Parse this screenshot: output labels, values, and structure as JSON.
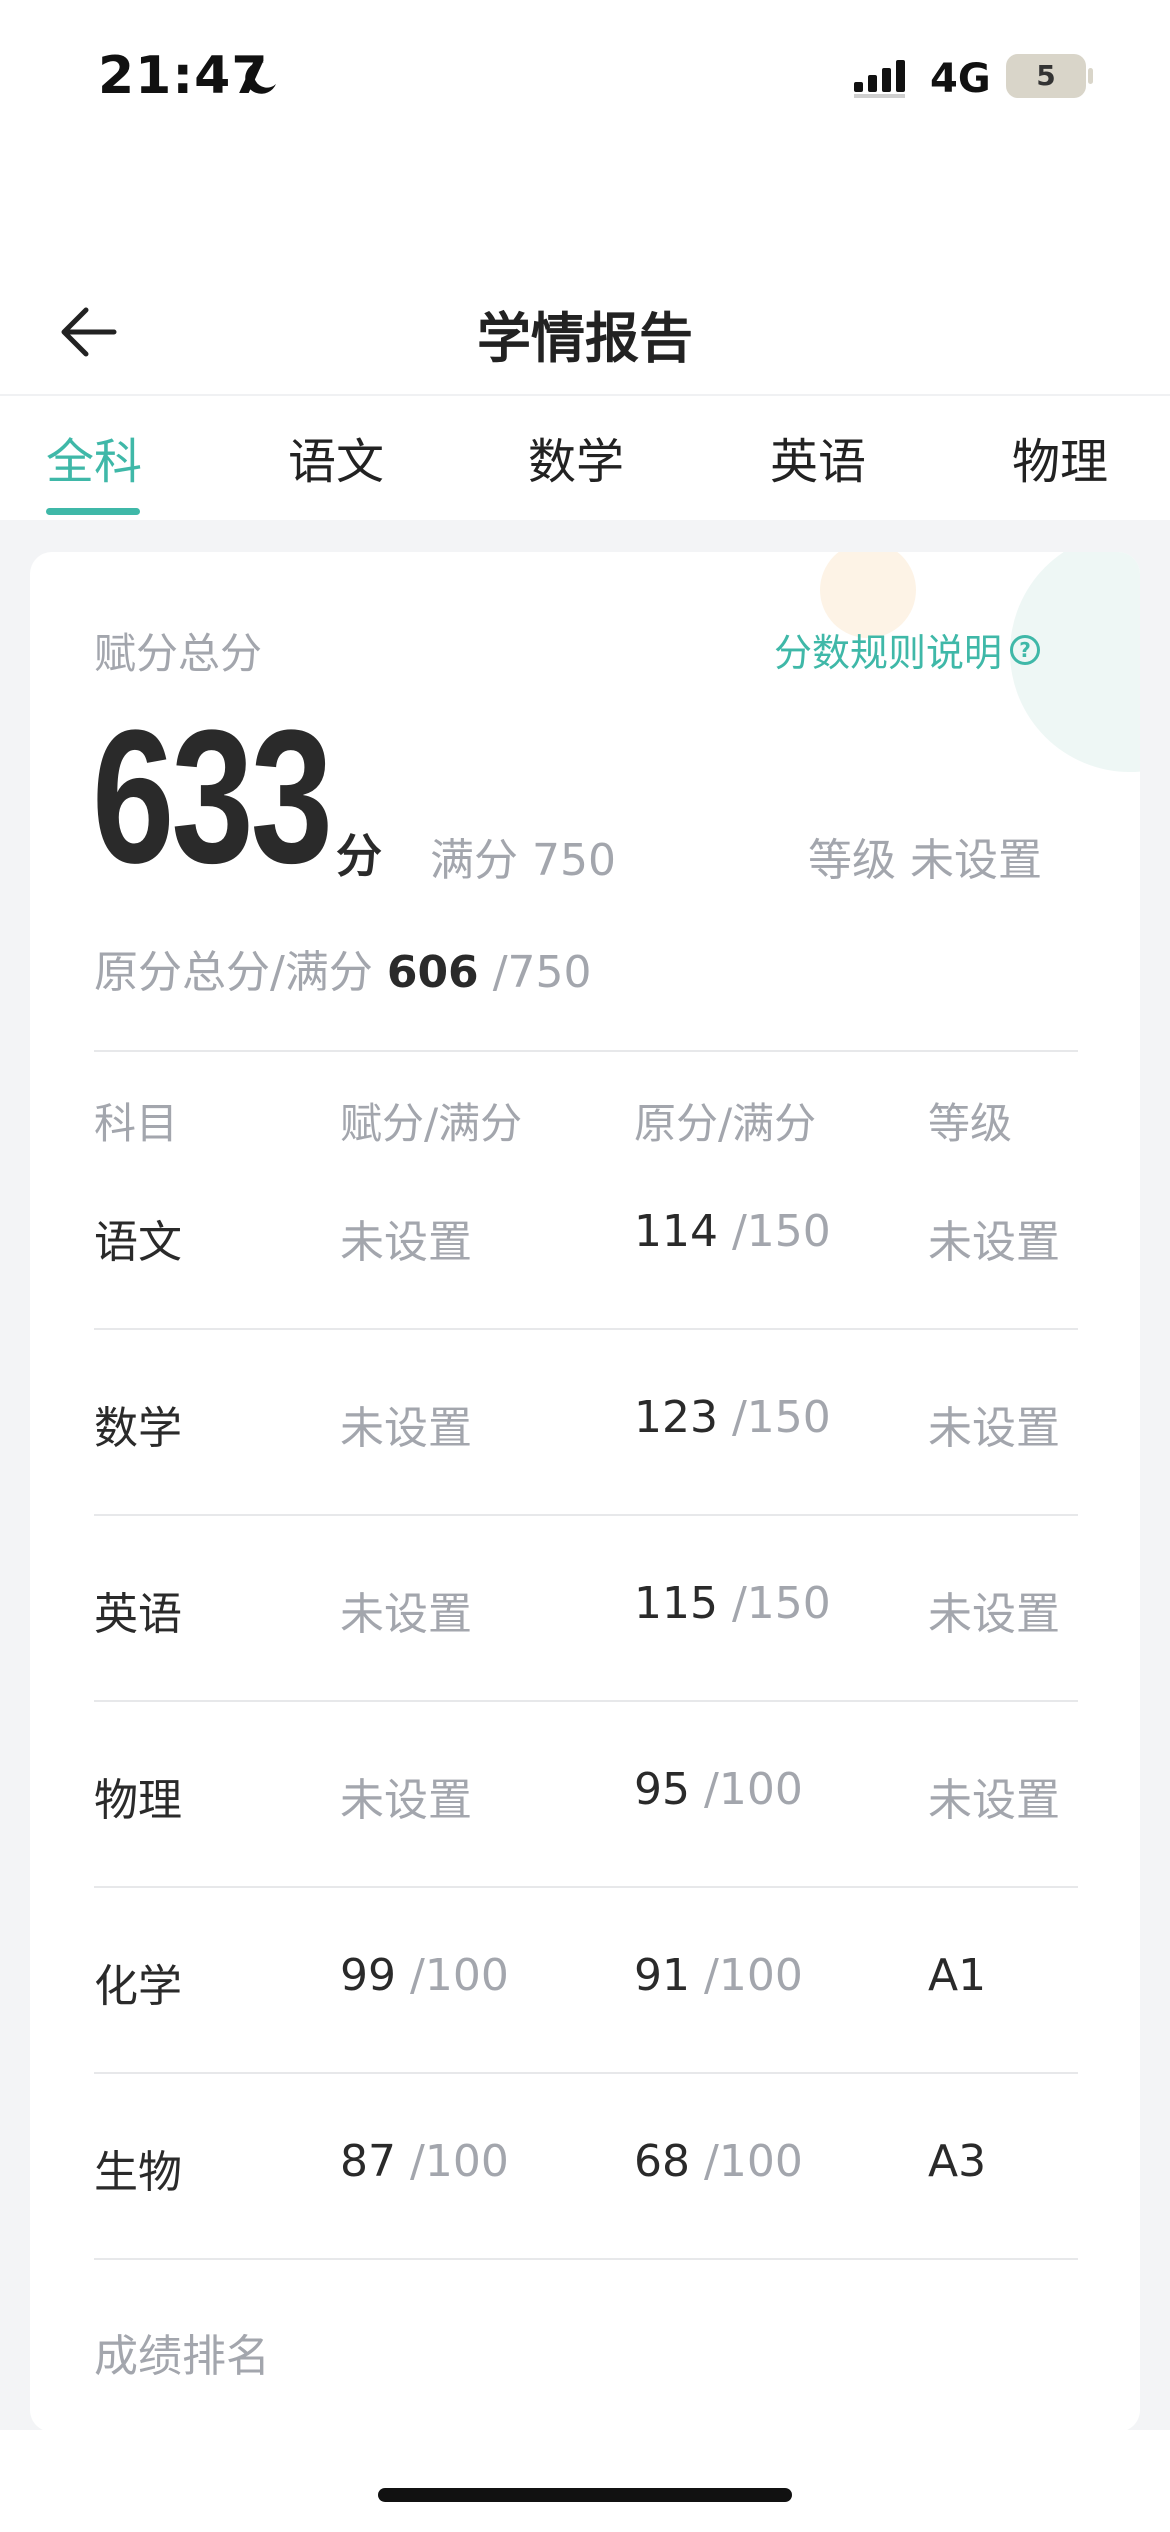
{
  "status_bar": {
    "time": "21:47",
    "network": "4G",
    "battery": "5"
  },
  "nav": {
    "title": "学情报告",
    "back_icon": "arrow-left-icon"
  },
  "tabs": [
    {
      "label": "全科",
      "active": true
    },
    {
      "label": "语文",
      "active": false
    },
    {
      "label": "数学",
      "active": false
    },
    {
      "label": "英语",
      "active": false
    },
    {
      "label": "物理",
      "active": false
    }
  ],
  "summary": {
    "total_label": "赋分总分",
    "rules_link": "分数规则说明",
    "score": "633",
    "score_unit": "分",
    "full_label": "满分",
    "full_value": "750",
    "grade_label": "等级",
    "grade_value": "未设置",
    "raw_label": "原分总分/满分",
    "raw_value": "606",
    "raw_full": "/750"
  },
  "table": {
    "headers": [
      "科目",
      "赋分/满分",
      "原分/满分",
      "等级"
    ],
    "rows": [
      {
        "subject": "语文",
        "assigned": "未设置",
        "assigned_full": "",
        "raw": "114",
        "raw_full": "/150",
        "grade": "未设置"
      },
      {
        "subject": "数学",
        "assigned": "未设置",
        "assigned_full": "",
        "raw": "123",
        "raw_full": "/150",
        "grade": "未设置"
      },
      {
        "subject": "英语",
        "assigned": "未设置",
        "assigned_full": "",
        "raw": "115",
        "raw_full": "/150",
        "grade": "未设置"
      },
      {
        "subject": "物理",
        "assigned": "未设置",
        "assigned_full": "",
        "raw": "95",
        "raw_full": "/100",
        "grade": "未设置"
      },
      {
        "subject": "化学",
        "assigned": "99",
        "assigned_full": "/100",
        "raw": "91",
        "raw_full": "/100",
        "grade": "A1"
      },
      {
        "subject": "生物",
        "assigned": "87",
        "assigned_full": "/100",
        "raw": "68",
        "raw_full": "/100",
        "grade": "A3"
      }
    ]
  },
  "rank_section": {
    "title": "成绩排名"
  },
  "colors": {
    "accent": "#3fb8a8",
    "muted": "#a3a6ad",
    "text": "#2a2a2a",
    "background": "#f3f4f6"
  }
}
